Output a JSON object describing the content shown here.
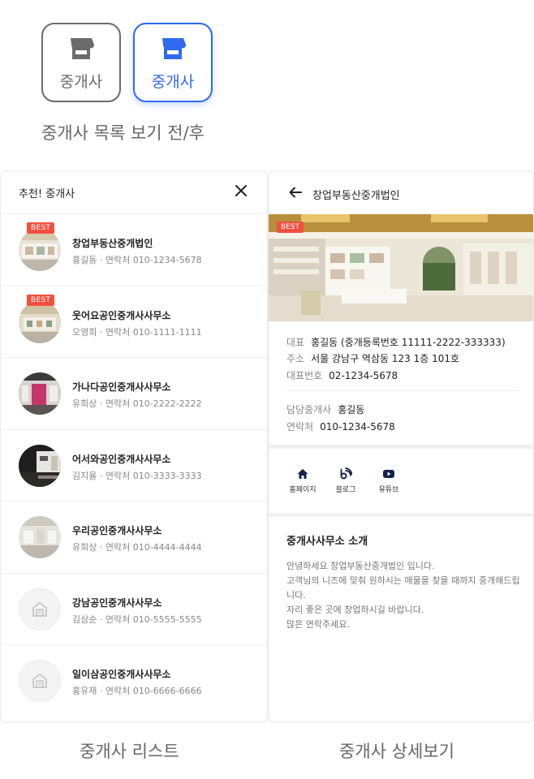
{
  "buttons": [
    {
      "label": "중개사",
      "state": "before"
    },
    {
      "label": "중개사",
      "state": "after"
    }
  ],
  "captions": {
    "toggle": "중개사 목록 보기 전/후",
    "list": "중개사 리스트",
    "detail": "중개사 상세보기"
  },
  "list": {
    "title": "추천! 중개사",
    "badge": "BEST",
    "items": [
      {
        "name": "창업부동산중개법인",
        "agent": "홍길동 · 연락처 010-1234-5678",
        "best": true
      },
      {
        "name": "웃어요공인중개사사무소",
        "agent": "오영희 · 연락처 010-1111-1111",
        "best": true
      },
      {
        "name": "가나다공인중개사사무소",
        "agent": "유희상 · 연락처 010-2222-2222",
        "best": false
      },
      {
        "name": "어서와공인중개사사무소",
        "agent": "김지율 · 연락처 010-3333-3333",
        "best": false
      },
      {
        "name": "우리공인중개사사무소",
        "agent": "유희상 · 연락처 010-4444-4444",
        "best": false
      },
      {
        "name": "강남공인중개사사무소",
        "agent": "김삼순 · 연락처 010-5555-5555",
        "best": false
      },
      {
        "name": "일이삼공인중개사사무소",
        "agent": "홍유재 · 연락처 010-6666-6666",
        "best": false
      }
    ]
  },
  "detail": {
    "title": "창업부동산중개법인",
    "badge": "BEST",
    "rep_k": "대표",
    "rep_v": "홍길동 (중개등록번호 11111-2222-333333)",
    "addr_k": "주소",
    "addr_v": "서울 강남구 역삼동 123 1층 101호",
    "tel_k": "대표번호",
    "tel_v": "02-1234-5678",
    "agent_k": "담당중개사",
    "agent_v": "홍길동",
    "phone_k": "연락처",
    "phone_v": "010-1234-5678",
    "links": [
      "홈페이지",
      "블로그",
      "유튜브"
    ],
    "intro_title": "중개사사무소 소개",
    "intro": "안녕하세요 창업부동산중개법인 입니다.\n고객님의 니즈에 맞춰 원하시는 매물을 찾을 때까지 중개해드립니다.\n자리 좋은 곳에 창업하시길 바랍니다.\n많은 연락주세요."
  },
  "colors": {
    "accent": "#2f6bec",
    "best": "#f2503f",
    "muted": "#888888"
  },
  "icons": [
    "store-icon",
    "close-icon",
    "back-arrow-icon",
    "home-icon",
    "blog-icon",
    "youtube-icon",
    "building-icon"
  ]
}
